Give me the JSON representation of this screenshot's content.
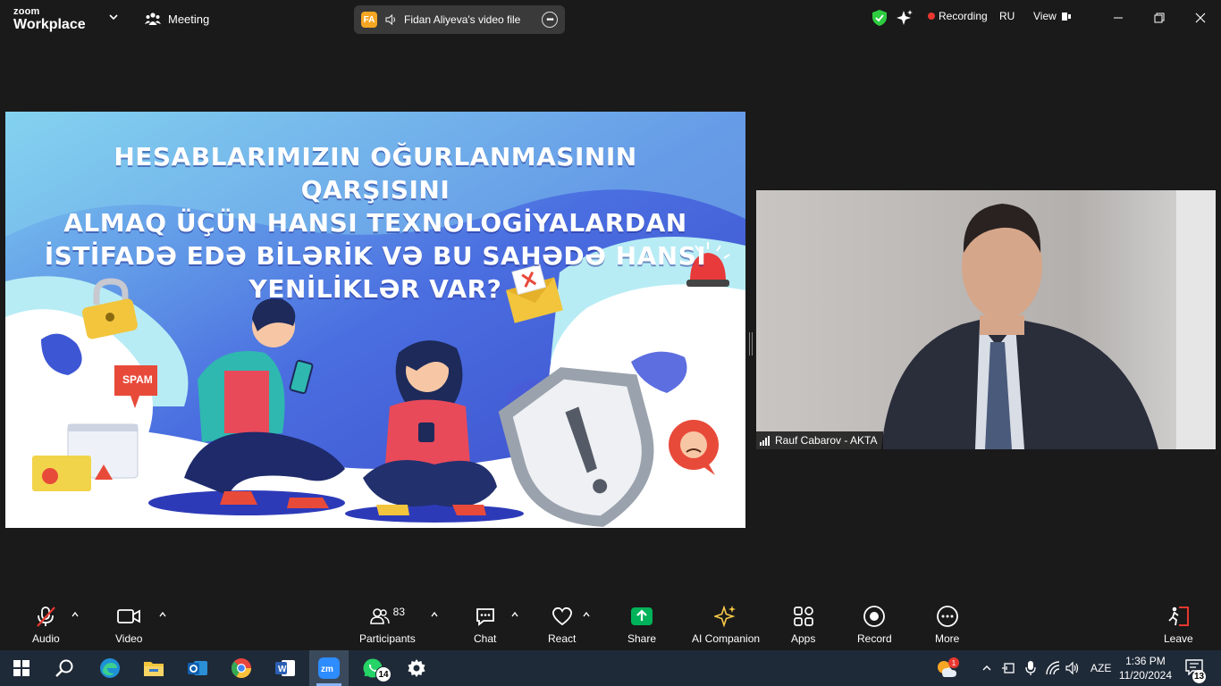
{
  "app": {
    "logo_line1": "zoom",
    "logo_line2": "Workplace",
    "meeting_label": "Meeting",
    "share_initials": "FA",
    "share_title": "Fidan Aliyeva's video file",
    "recording_label": "Recording",
    "language": "RU",
    "view_label": "View"
  },
  "slide": {
    "title_lines": [
      "HESABLARIMIZIN OĞURLANMASININ QARŞISINI",
      "ALMAQ ÜÇÜN HANSI TEXNOLOGİYALARDAN",
      "İSTİFADƏ EDƏ BİLƏRİK VƏ BU SAHƏDƏ HANSI",
      "YENİLİKLƏR VAR?"
    ],
    "spam_label": "SPAM"
  },
  "video": {
    "participant_name": "Rauf Cabarov - AKTA"
  },
  "toolbar": {
    "audio": "Audio",
    "video": "Video",
    "participants": "Participants",
    "participants_count": "83",
    "chat": "Chat",
    "react": "React",
    "share": "Share",
    "ai_companion": "AI Companion",
    "apps": "Apps",
    "record": "Record",
    "more": "More",
    "leave": "Leave"
  },
  "taskbar": {
    "whatsapp_badge": "14",
    "weather_badge": "1",
    "input_lang": "AZE",
    "time": "1:36 PM",
    "date": "11/20/2024",
    "notifications": "13"
  },
  "colors": {
    "share_green": "#00b259",
    "recording_red": "#e8372f",
    "leave_red": "#e8372f",
    "ai_yellow": "#f7c948",
    "shield_green": "#2ecc40"
  }
}
